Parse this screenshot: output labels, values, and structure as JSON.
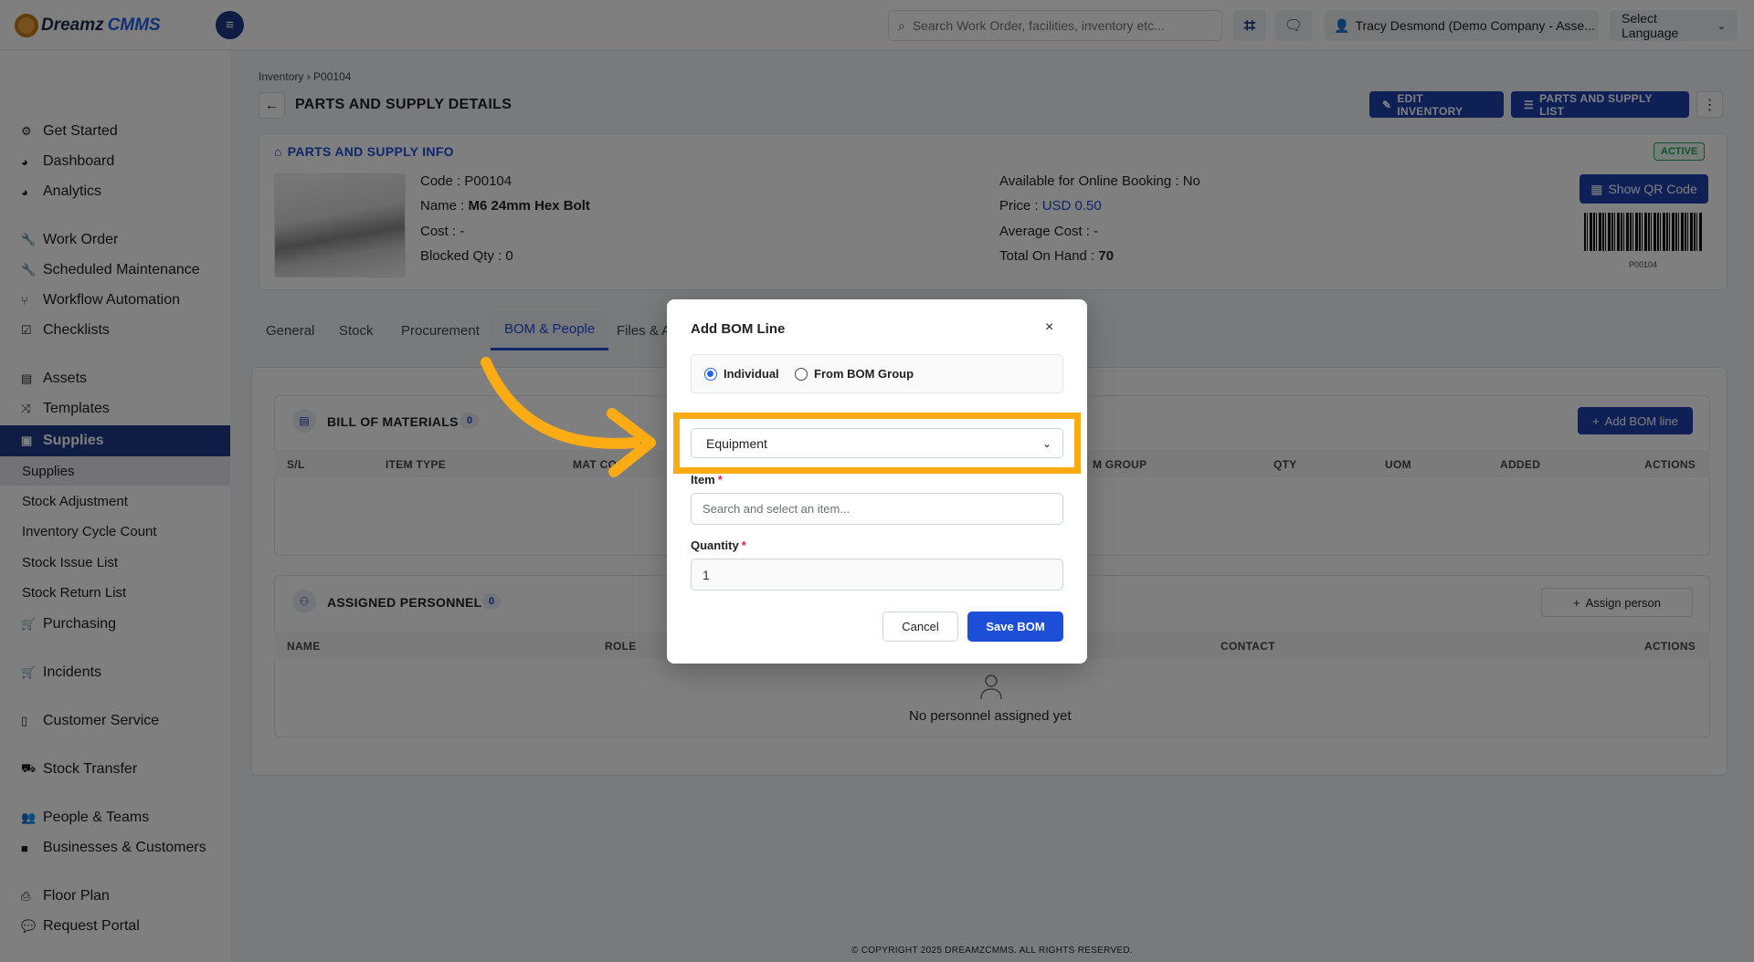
{
  "app": {
    "brand_part1": "Dreamz",
    "brand_part2": "CMMS",
    "search_placeholder": "Search Work Order, facilities, inventory etc...",
    "user_label": "Tracy Desmond (Demo Company - Asse...",
    "language_label": "Select Language"
  },
  "sidebar": {
    "items": [
      {
        "label": "Get Started",
        "icon": "settings-icon"
      },
      {
        "label": "Dashboard",
        "icon": "dashboard-icon"
      },
      {
        "label": "Analytics",
        "icon": "analytics-icon"
      },
      {
        "label": "Work Order",
        "icon": "wrench-icon"
      },
      {
        "label": "Scheduled Maintenance",
        "icon": "wrench-icon"
      },
      {
        "label": "Workflow Automation",
        "icon": "branch-icon"
      },
      {
        "label": "Checklists",
        "icon": "checkbox-icon"
      },
      {
        "label": "Assets",
        "icon": "assets-icon"
      },
      {
        "label": "Templates",
        "icon": "shuffle-icon"
      },
      {
        "label": "Supplies",
        "icon": "supplies-icon"
      },
      {
        "label": "Purchasing",
        "icon": "cart-icon"
      },
      {
        "label": "Incidents",
        "icon": "cart-icon"
      },
      {
        "label": "Customer Service",
        "icon": "file-icon"
      },
      {
        "label": "Stock Transfer",
        "icon": "truck-icon"
      },
      {
        "label": "People & Teams",
        "icon": "users-icon"
      },
      {
        "label": "Businesses & Customers",
        "icon": "video-icon"
      },
      {
        "label": "Floor Plan",
        "icon": "printer-icon"
      },
      {
        "label": "Request Portal",
        "icon": "chat-icon"
      }
    ],
    "sub_items": [
      "Supplies",
      "Stock Adjustment",
      "Inventory Cycle Count",
      "Stock Issue List",
      "Stock Return List"
    ]
  },
  "page": {
    "breadcrumb_parent": "Inventory",
    "breadcrumb_sep": "›",
    "breadcrumb_current": "P00104",
    "title": "PARTS AND SUPPLY DETAILS",
    "edit_button": "EDIT INVENTORY",
    "list_button": "PARTS AND SUPPLY LIST"
  },
  "info": {
    "heading": "PARTS AND SUPPLY INFO",
    "status": "ACTIVE",
    "code_label": "Code :",
    "code": "P00104",
    "name_label": "Name :",
    "name": "M6 24mm Hex Bolt",
    "cost_label": "Cost :",
    "cost": "-",
    "blocked_label": "Blocked Qty :",
    "blocked": "0",
    "online_label": "Available for Online Booking :",
    "online": "No",
    "price_label": "Price :",
    "price": "USD 0.50",
    "avg_cost_label": "Average Cost :",
    "avg_cost": "-",
    "on_hand_label": "Total On Hand :",
    "on_hand": "70",
    "qr_button": "Show QR Code",
    "barcode_text": "P00104"
  },
  "tabs": [
    "General",
    "Stock",
    "Procurement",
    "BOM & People",
    "Files & A"
  ],
  "bom": {
    "title": "BILL OF MATERIALS",
    "count": "0",
    "add_button": "Add BOM line",
    "columns": [
      "S/L",
      "ITEM TYPE",
      "MAT CO",
      "M GROUP",
      "QTY",
      "UOM",
      "ADDED",
      "ACTIONS"
    ]
  },
  "personnel": {
    "title": "ASSIGNED PERSONNEL",
    "count": "0",
    "assign_button": "Assign person",
    "columns": [
      "NAME",
      "ROLE",
      "CONTACT",
      "ACTIONS"
    ],
    "empty_text": "No personnel assigned yet"
  },
  "modal": {
    "title": "Add BOM Line",
    "radio_individual": "Individual",
    "radio_group": "From BOM Group",
    "type_value": "Equipment",
    "item_label": "Item",
    "item_placeholder": "Search and select an item...",
    "quantity_label": "Quantity",
    "quantity_value": "1",
    "cancel": "Cancel",
    "save": "Save BOM"
  },
  "footer": "© COPYRIGHT 2025 DREAMZCMMS. ALL RIGHTS RESERVED.",
  "colors": {
    "primary": "#1e40af",
    "highlight": "#fbab14",
    "active_status": "#22a35a"
  }
}
